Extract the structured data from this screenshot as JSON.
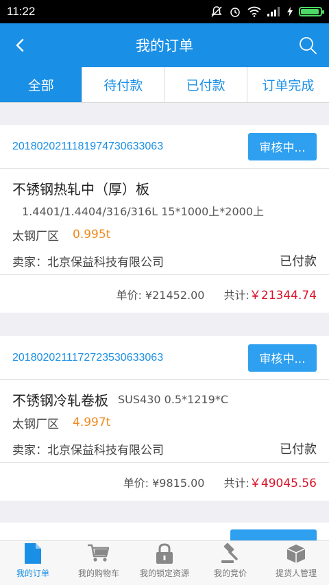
{
  "status_bar": {
    "time": "11:22"
  },
  "nav": {
    "title": "我的订单"
  },
  "tabs": [
    {
      "label": "全部",
      "active": true
    },
    {
      "label": "待付款",
      "active": false
    },
    {
      "label": "已付款",
      "active": false
    },
    {
      "label": "订单完成",
      "active": false
    }
  ],
  "orders": [
    {
      "order_no": "2018020211181974730633063",
      "status": "审核中...",
      "product": "不锈钢热轧中（厚）板",
      "spec": "1.4401/1.4404/316/316L   15*1000上*2000上",
      "location": "太钢厂区",
      "weight": "0.995t",
      "seller": "卖家：北京保益科技有限公司",
      "pay_status": "已付款",
      "unit_price": "单价: ¥21452.00",
      "total_label": "共计:",
      "total": "￥21344.74"
    },
    {
      "order_no": "2018020211172723530633063",
      "status": "审核中...",
      "product": "不锈钢冷轧卷板",
      "spec": "SUS430   0.5*1219*C",
      "location": "太钢厂区",
      "weight": "4.997t",
      "seller": "卖家：北京保益科技有限公司",
      "pay_status": "已付款",
      "unit_price": "单价: ¥9815.00",
      "total_label": "共计:",
      "total": "￥49045.56"
    }
  ],
  "tabbar": [
    {
      "label": "我的订单",
      "icon": "document-icon",
      "active": true
    },
    {
      "label": "我的购物车",
      "icon": "cart-icon",
      "active": false
    },
    {
      "label": "我的锁定资源",
      "icon": "lock-icon",
      "active": false
    },
    {
      "label": "我的竞价",
      "icon": "gavel-icon",
      "active": false
    },
    {
      "label": "提货人管理",
      "icon": "box-icon",
      "active": false
    }
  ],
  "colors": {
    "primary": "#1a8fe6",
    "weight": "#f08a1c",
    "total": "#d9152b",
    "battery": "#4cd964"
  }
}
